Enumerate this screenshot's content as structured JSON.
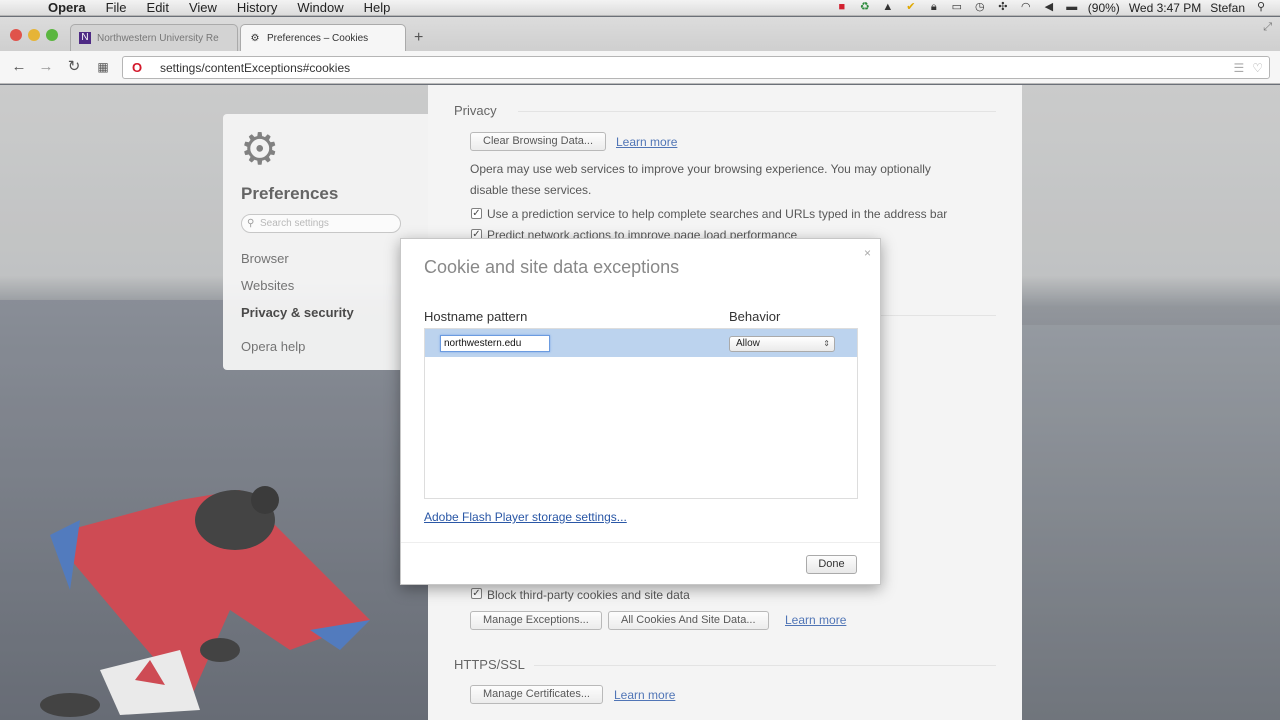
{
  "menubar": {
    "app": "Opera",
    "menus": [
      "File",
      "Edit",
      "View",
      "History",
      "Window",
      "Help"
    ],
    "battery": "(90%)",
    "clock": "Wed 3:47 PM",
    "user": "Stefan"
  },
  "tabs": [
    {
      "label": "Northwestern University Re",
      "icon": "northwestern-favicon"
    },
    {
      "label": "Preferences – Cookies",
      "icon": "gear-icon"
    }
  ],
  "address": {
    "url": "settings/contentExceptions#cookies"
  },
  "sidebar": {
    "title": "Preferences",
    "search_placeholder": "Search settings",
    "items": [
      "Browser",
      "Websites",
      "Privacy & security",
      "Opera help"
    ]
  },
  "content": {
    "privacy_heading": "Privacy",
    "clear_btn": "Clear Browsing Data...",
    "learn_more": "Learn more",
    "services_line1": "Opera may use web services to improve your browsing experience. You may optionally",
    "services_line2": "disable these services.",
    "check1": "Use a prediction service to help complete searches and URLs typed in the address bar",
    "check2": "Predict network actions to improve page load performance",
    "block_third": "Block third-party cookies and site data",
    "manage_exceptions": "Manage Exceptions...",
    "all_cookies": "All Cookies And Site Data...",
    "https_heading": "HTTPS/SSL",
    "manage_certs": "Manage Certificates..."
  },
  "dialog": {
    "title": "Cookie and site data exceptions",
    "col_host": "Hostname pattern",
    "col_behavior": "Behavior",
    "host_value": "northwestern.edu",
    "behavior_value": "Allow",
    "flash_link": "Adobe Flash Player storage settings...",
    "done": "Done"
  }
}
